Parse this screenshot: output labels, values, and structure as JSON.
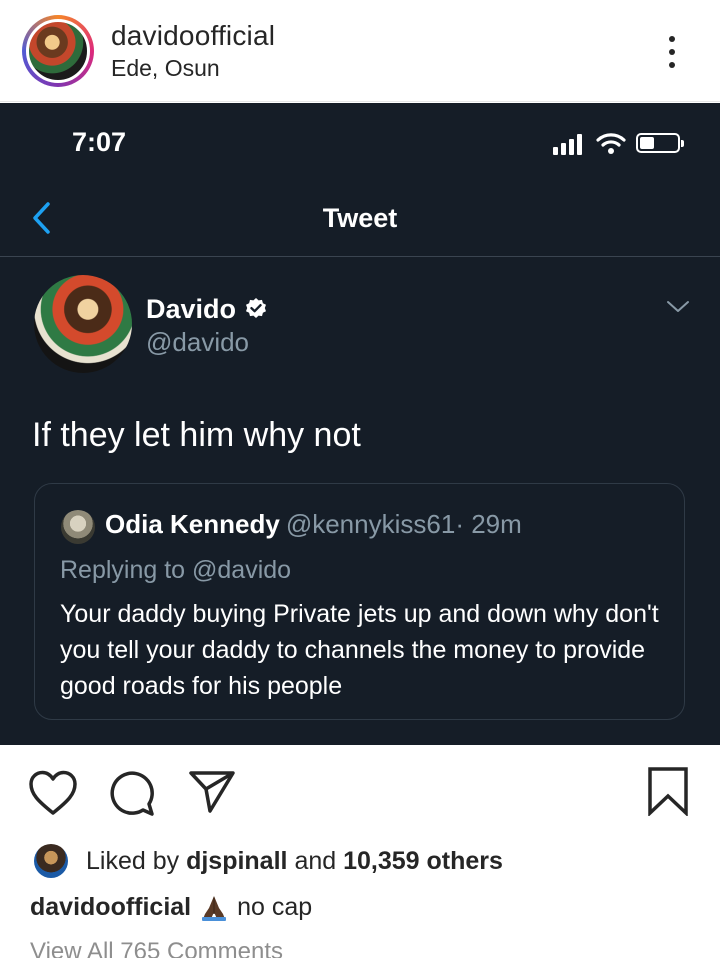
{
  "post_header": {
    "username": "davidoofficial",
    "location": "Ede, Osun",
    "more_icon": "more-vertical-icon"
  },
  "tweet_screenshot": {
    "status_bar": {
      "time": "7:07",
      "icons": [
        "signal-icon",
        "wifi-icon",
        "battery-icon"
      ]
    },
    "nav": {
      "back_icon": "chevron-left-icon",
      "title": "Tweet"
    },
    "tweet": {
      "author_name": "Davido",
      "verified_icon": "verified-badge-icon",
      "author_handle": "@davido",
      "options_icon": "chevron-down-icon",
      "text": "If they let him why not",
      "quoted": {
        "name": "Odia Kennedy",
        "handle": "@kennykiss61",
        "time": "· 29m",
        "replying_to": "Replying to @davido",
        "body": "Your daddy buying Private jets up and down why don't you tell your daddy to channels the money to provide good roads for his people"
      }
    },
    "colors": {
      "background": "#151d27",
      "link_blue": "#1da1f2",
      "secondary_text": "#8899a6"
    }
  },
  "actions": {
    "like_icon": "heart-icon",
    "comment_icon": "comment-icon",
    "share_icon": "send-icon",
    "save_icon": "bookmark-icon"
  },
  "likes": {
    "prefix": "Liked by",
    "user": "djspinall",
    "middle": "and",
    "others": "10,359 others"
  },
  "caption": {
    "username": "davidoofficial",
    "emoji_icon": "praying-hands-icon",
    "text": "no cap"
  },
  "comments_link": "View All 765 Comments"
}
